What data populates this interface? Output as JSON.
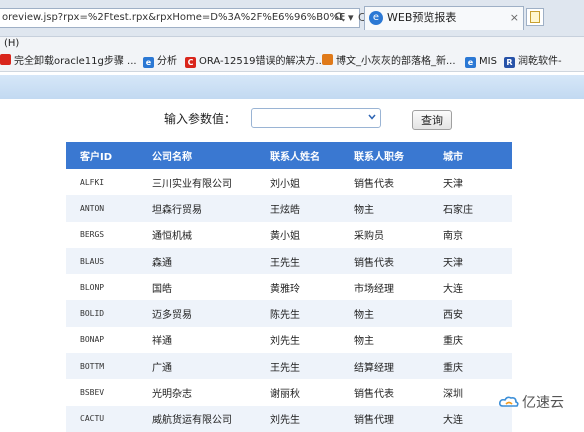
{
  "browser": {
    "address": "oreview.jsp?rpx=%2Ftest.rpx&rpxHome=D%3A%2F%E6%96%B0%E",
    "search_icon": "search-icon",
    "refresh_glyph": "C",
    "tab_title": "WEB预览报表",
    "tab_close": "×",
    "menu": "(H)"
  },
  "favorites": [
    {
      "label": "完全卸载oracle11g步骤 ...",
      "color": "#d9261c"
    },
    {
      "label": "分析",
      "color": "#2b78d4"
    },
    {
      "label": "ORA-12519错误的解决方...",
      "color": "#d9261c"
    },
    {
      "label": "博文_小灰灰的部落格_新...",
      "color": "#e07a1a"
    },
    {
      "label": "MIS",
      "color": "#2b78d4"
    },
    {
      "label": "润乾软件-",
      "color": "#2752a8"
    }
  ],
  "form": {
    "param_label": "输入参数值：",
    "query_button": "查询"
  },
  "table": {
    "headers": [
      "客户ID",
      "公司名称",
      "联系人姓名",
      "联系人职务",
      "城市"
    ],
    "rows": [
      [
        "ALFKI",
        "三川实业有限公司",
        "刘小姐",
        "销售代表",
        "天津"
      ],
      [
        "ANTON",
        "坦森行贸易",
        "王炫皓",
        "物主",
        "石家庄"
      ],
      [
        "BERGS",
        "通恒机械",
        "黄小姐",
        "采购员",
        "南京"
      ],
      [
        "BLAUS",
        "森通",
        "王先生",
        "销售代表",
        "天津"
      ],
      [
        "BLONP",
        "国皓",
        "黄雅玲",
        "市场经理",
        "大连"
      ],
      [
        "BOLID",
        "迈多贸易",
        "陈先生",
        "物主",
        "西安"
      ],
      [
        "BONAP",
        "祥通",
        "刘先生",
        "物主",
        "重庆"
      ],
      [
        "BOTTM",
        "广通",
        "王先生",
        "结算经理",
        "重庆"
      ],
      [
        "BSBEV",
        "光明杂志",
        "谢丽秋",
        "销售代表",
        "深圳"
      ],
      [
        "CACTU",
        "威航货运有限公司",
        "刘先生",
        "销售代理",
        "大连"
      ]
    ]
  },
  "watermark": {
    "text": "亿速云",
    "icon": "cloud-logo-icon"
  }
}
